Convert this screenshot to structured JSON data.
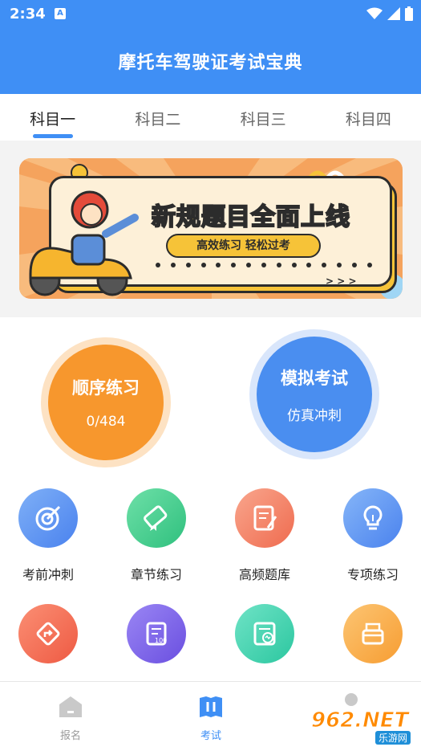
{
  "status_bar": {
    "time": "2:34",
    "notification_badge": "A"
  },
  "header": {
    "title": "摩托车驾驶证考试宝典",
    "color": "#3f8ff5"
  },
  "tabs": [
    {
      "label": "科目一",
      "active": true
    },
    {
      "label": "科目二",
      "active": false
    },
    {
      "label": "科目三",
      "active": false
    },
    {
      "label": "科目四",
      "active": false
    }
  ],
  "banner": {
    "headline": "新规题目全面上线",
    "subtitle": "高效练习 轻松过考",
    "arrows": "> > >"
  },
  "main_buttons": {
    "sequential": {
      "title": "顺序练习",
      "progress": "0/484",
      "color": "#f7972d"
    },
    "mock_exam": {
      "title": "模拟考试",
      "subtitle": "仿真冲刺",
      "color": "#4a8ef0"
    }
  },
  "grid_row1": [
    {
      "label": "考前冲刺",
      "icon": "target-icon",
      "color": "#5b93f2"
    },
    {
      "label": "章节练习",
      "icon": "scroll-icon",
      "color": "#3fcf8e"
    },
    {
      "label": "高频题库",
      "icon": "high-frequency-icon",
      "color": "#f4876a"
    },
    {
      "label": "专项练习",
      "icon": "lightbulb-icon",
      "color": "#5b93f2"
    }
  ],
  "grid_row2": [
    {
      "icon": "traffic-sign-icon",
      "color": "#f46f55"
    },
    {
      "icon": "score-sheet-icon",
      "color": "#7b62ea"
    },
    {
      "icon": "analysis-icon",
      "color": "#35cfae"
    },
    {
      "icon": "tray-icon",
      "color": "#f9b04b"
    }
  ],
  "bottom_nav": [
    {
      "label": "报名",
      "icon": "home-icon",
      "active": false
    },
    {
      "label": "考试",
      "icon": "book-icon",
      "active": true
    }
  ],
  "watermark": {
    "brand": "962.NET",
    "sub": "乐游网"
  }
}
